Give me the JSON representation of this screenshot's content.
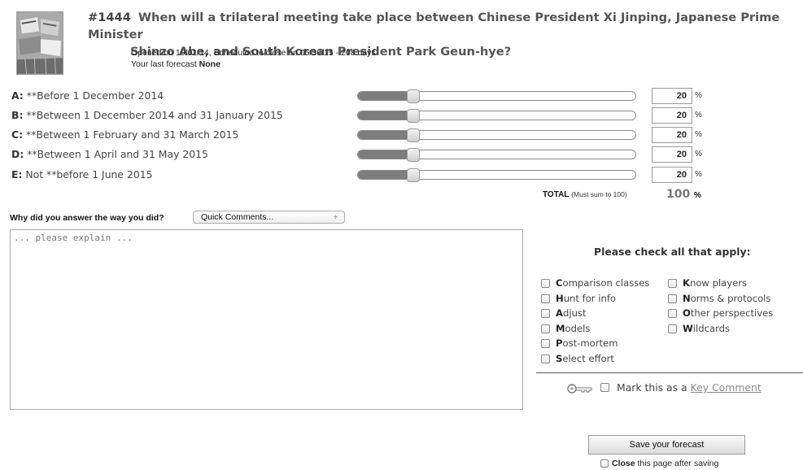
{
  "question": {
    "number": "#1444",
    "title_line1": "When will a trilateral meeting take place between Chinese President Xi Jinping, Japanese Prime Minister",
    "title_line2": "Shinzo Abe, and South Korean President Park Geun-hye?",
    "opened_text": "Opened on 10/01/14, Scheduled to close on 05/30/15 - 208 days",
    "last_forecast_label": "Your last forecast",
    "last_forecast_value": "None"
  },
  "options": [
    {
      "letter": "A:",
      "label": "**Before 1 December 2014",
      "value": "20",
      "fraction": 0.2
    },
    {
      "letter": "B:",
      "label": "**Between 1 December 2014 and 31 January 2015",
      "value": "20",
      "fraction": 0.2
    },
    {
      "letter": "C:",
      "label": "**Between 1 February and 31 March 2015",
      "value": "20",
      "fraction": 0.2
    },
    {
      "letter": "D:",
      "label": "**Between 1 April and 31 May 2015",
      "value": "20",
      "fraction": 0.2
    },
    {
      "letter": "E:",
      "label": "Not **before 1 June 2015",
      "value": "20",
      "fraction": 0.2
    }
  ],
  "percent_sign": "%",
  "total": {
    "label": "TOTAL",
    "note": "(Must sum to 100)",
    "value": "100",
    "sign": "%"
  },
  "comment": {
    "why_label": "Why did you answer the way you did?",
    "quick_comments": "Quick Comments...",
    "quick_arrows": "÷",
    "placeholder": "... please explain ..."
  },
  "apply": {
    "title": "Please check all that apply:",
    "left": [
      {
        "initial": "C",
        "rest": "omparison classes"
      },
      {
        "initial": "H",
        "rest": "unt for info"
      },
      {
        "initial": "A",
        "rest": "djust"
      },
      {
        "initial": "M",
        "rest": "odels"
      },
      {
        "initial": "P",
        "rest": "ost-mortem"
      },
      {
        "initial": "S",
        "rest": "elect effort"
      }
    ],
    "right": [
      {
        "initial": "K",
        "rest": "now players"
      },
      {
        "initial": "N",
        "rest": "orms & protocols"
      },
      {
        "initial": "O",
        "rest": "ther perspectives"
      },
      {
        "initial": "W",
        "rest": "ildcards"
      }
    ]
  },
  "key_comment": {
    "prefix": "Mark this as a",
    "link": "Key Comment"
  },
  "save": {
    "button": "Save your forecast",
    "close_bold": "Close",
    "close_rest": " this page after saving"
  },
  "colors": {
    "slider_fill": "#7d7d7d",
    "total_value": "#777777",
    "link": "#8a8a8a"
  }
}
